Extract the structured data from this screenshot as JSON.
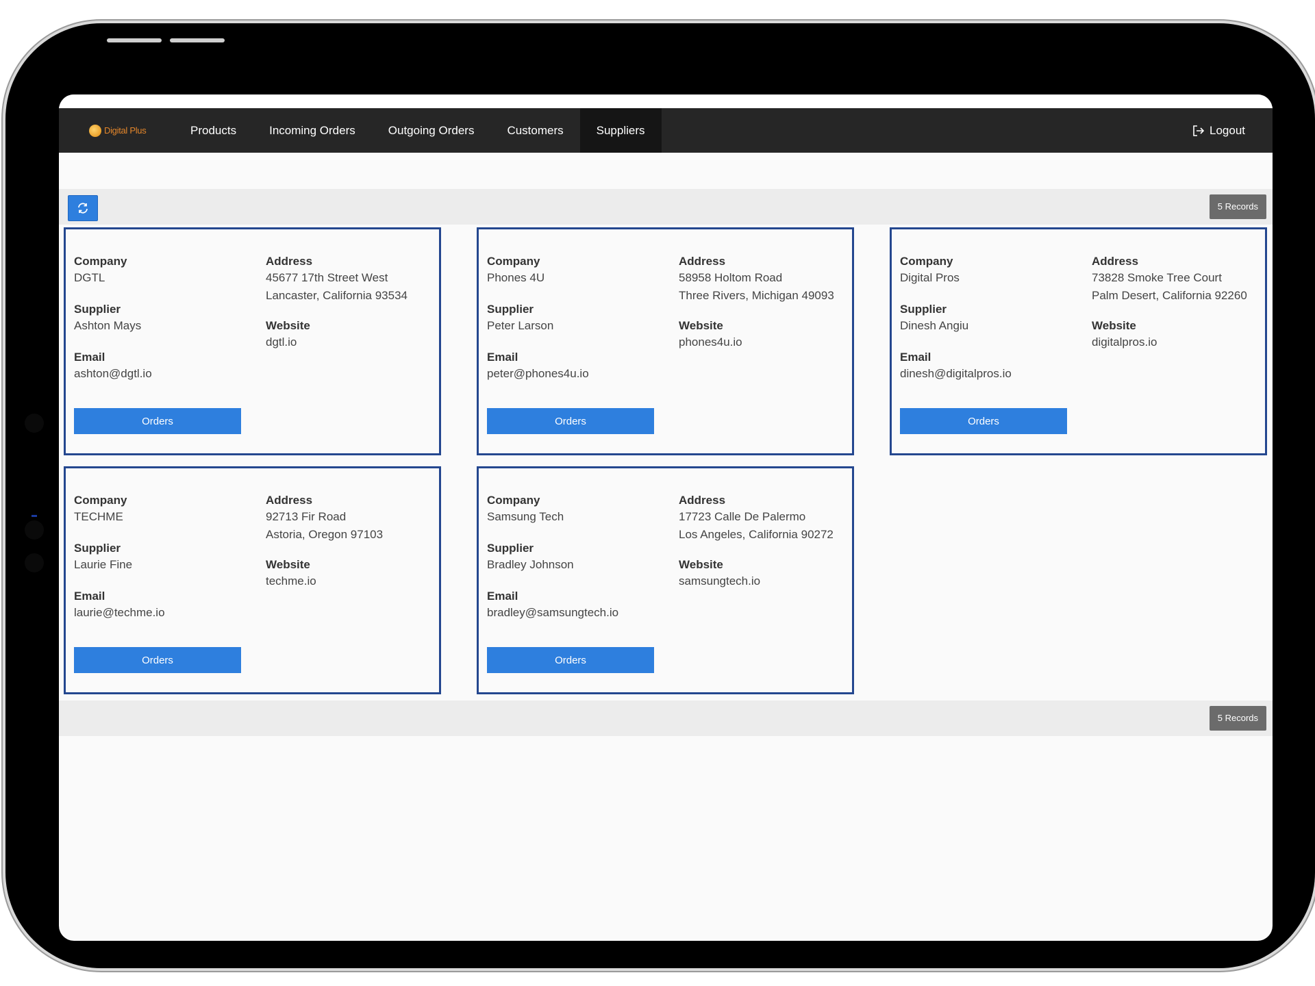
{
  "nav": {
    "brand": "Digital Plus",
    "items": [
      "Products",
      "Incoming Orders",
      "Outgoing Orders",
      "Customers",
      "Suppliers"
    ],
    "active": "Suppliers",
    "logout": "Logout"
  },
  "toolbar": {
    "records": "5 Records"
  },
  "footer": {
    "records": "5 Records"
  },
  "labels": {
    "company": "Company",
    "supplier": "Supplier",
    "email": "Email",
    "address": "Address",
    "website": "Website",
    "orders": "Orders"
  },
  "suppliers": [
    {
      "company": "DGTL",
      "supplier": "Ashton Mays",
      "email": "ashton@dgtl.io",
      "address1": "45677 17th Street West",
      "address2": "Lancaster, California 93534",
      "website": "dgtl.io"
    },
    {
      "company": "Phones 4U",
      "supplier": "Peter Larson",
      "email": "peter@phones4u.io",
      "address1": "58958 Holtom Road",
      "address2": "Three Rivers, Michigan 49093",
      "website": "phones4u.io"
    },
    {
      "company": "Digital Pros",
      "supplier": "Dinesh Angiu",
      "email": "dinesh@digitalpros.io",
      "address1": "73828 Smoke Tree Court",
      "address2": "Palm Desert, California 92260",
      "website": "digitalpros.io"
    },
    {
      "company": "TECHME",
      "supplier": "Laurie Fine",
      "email": "laurie@techme.io",
      "address1": "92713 Fir Road",
      "address2": "Astoria, Oregon 97103",
      "website": "techme.io"
    },
    {
      "company": "Samsung Tech",
      "supplier": "Bradley Johnson",
      "email": "bradley@samsungtech.io",
      "address1": "17723 Calle De Palermo",
      "address2": "Los Angeles, California 90272",
      "website": "samsungtech.io"
    }
  ],
  "colors": {
    "accent": "#2e7fde",
    "card_border": "#24478f",
    "nav_bg": "#262626",
    "records_badge": "#6b6b6b"
  }
}
